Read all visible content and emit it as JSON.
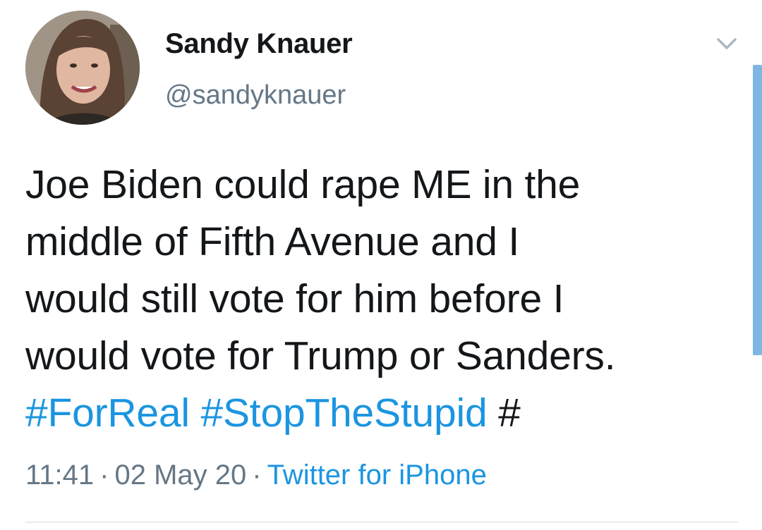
{
  "author": {
    "display_name": "Sandy Knauer",
    "handle": "@sandyknauer"
  },
  "tweet": {
    "lines": [
      "Joe Biden could rape ME in the",
      "middle of Fifth Avenue and I",
      "would still vote for him before I",
      "would vote for Trump or Sanders."
    ],
    "hashtags": [
      "#ForReal",
      "#StopTheStupid"
    ],
    "trailing_text": "#"
  },
  "meta": {
    "time": "11:41",
    "date": "02 May 20",
    "source": "Twitter for iPhone",
    "separator": "·"
  },
  "icons": {
    "menu": "chevron-down-icon"
  },
  "colors": {
    "text": "#14171a",
    "secondary": "#657786",
    "link": "#1b95e0"
  }
}
